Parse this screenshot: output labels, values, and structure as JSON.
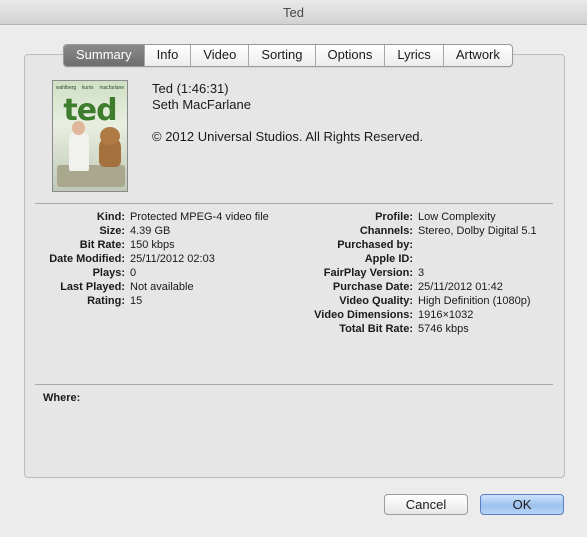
{
  "window": {
    "title": "Ted"
  },
  "tabs": [
    {
      "label": "Summary",
      "active": true
    },
    {
      "label": "Info",
      "active": false
    },
    {
      "label": "Video",
      "active": false
    },
    {
      "label": "Sorting",
      "active": false
    },
    {
      "label": "Options",
      "active": false
    },
    {
      "label": "Lyrics",
      "active": false
    },
    {
      "label": "Artwork",
      "active": false
    }
  ],
  "poster": {
    "title_text": "ted",
    "cast": [
      "wahlberg",
      "kunis",
      "macfarlane"
    ]
  },
  "summary": {
    "title_line": "Ted (1:46:31)",
    "director": "Seth MacFarlane",
    "copyright": "© 2012 Universal Studios. All Rights Reserved."
  },
  "details_left": [
    {
      "label": "Kind:",
      "value": "Protected MPEG-4 video file"
    },
    {
      "label": "Size:",
      "value": "4.39 GB"
    },
    {
      "label": "Bit Rate:",
      "value": "150 kbps"
    },
    {
      "label": "Date Modified:",
      "value": "25/11/2012 02:03"
    },
    {
      "label": "Plays:",
      "value": "0"
    },
    {
      "label": "Last Played:",
      "value": "Not available"
    },
    {
      "label": "Rating:",
      "value": "15"
    }
  ],
  "details_right": [
    {
      "label": "Profile:",
      "value": "Low Complexity"
    },
    {
      "label": "Channels:",
      "value": "Stereo, Dolby Digital 5.1"
    },
    {
      "label": "Purchased by:",
      "value": ""
    },
    {
      "label": "Apple ID:",
      "value": ""
    },
    {
      "label": "FairPlay Version:",
      "value": "3"
    },
    {
      "label": "Purchase Date:",
      "value": "25/11/2012 01:42"
    },
    {
      "label": "Video Quality:",
      "value": "High Definition (1080p)"
    },
    {
      "label": "Video Dimensions:",
      "value": "1916×1032"
    },
    {
      "label": "Total Bit Rate:",
      "value": "5746 kbps"
    }
  ],
  "where": {
    "label": "Where:",
    "value": ""
  },
  "buttons": {
    "cancel": "Cancel",
    "ok": "OK"
  },
  "colors": {
    "active_tab": "#7a7a7a",
    "ok_button": "#9cc1ee"
  }
}
